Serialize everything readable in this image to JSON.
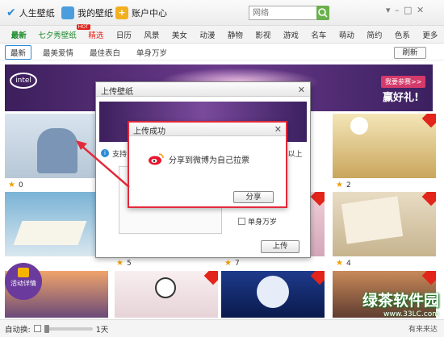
{
  "topbar": {
    "app_title": "人生壁纸",
    "my_wallpaper": "我的壁纸",
    "account_center": "账户中心",
    "search_placeholder": "网络"
  },
  "categories": [
    "最新",
    "七夕秀壁纸",
    "精选",
    "日历",
    "风景",
    "美女",
    "动漫",
    "静物",
    "影视",
    "游戏",
    "名车",
    "萌动",
    "简约",
    "色系",
    "更多"
  ],
  "hot_badge": "HOT",
  "subtabs": [
    "最新",
    "最美爱情",
    "最佳表白",
    "单身万岁"
  ],
  "refresh_label": "刷新",
  "banner": {
    "logo": "intel",
    "cta_label": "我要参赛>>",
    "prize_text": "赢好礼!"
  },
  "tiles": [
    {
      "count": "0"
    },
    {
      "count": "2"
    },
    {
      "count": "5"
    },
    {
      "count": "7"
    },
    {
      "count": "4"
    }
  ],
  "activity_label": "活动详情",
  "upload_dialog": {
    "title": "上传壁纸",
    "support_text": "支持",
    "size_text": "68以上",
    "checkbox_label": "单身万岁",
    "upload_button": "上传"
  },
  "success_dialog": {
    "title": "上传成功",
    "message": "分享到微博为自己拉票",
    "share_button": "分享"
  },
  "statusbar": {
    "auto_change_label": "自动换:",
    "interval": "1天",
    "footer_text": "有来来达"
  },
  "watermark": {
    "brand": "绿茶软件园",
    "url": "www.33LC.com"
  },
  "colors": {
    "accent_green": "#1a8a2a",
    "red_frame": "#e22a3c",
    "banner_purple": "#5a2f7c",
    "hot_red": "#e2241a"
  }
}
